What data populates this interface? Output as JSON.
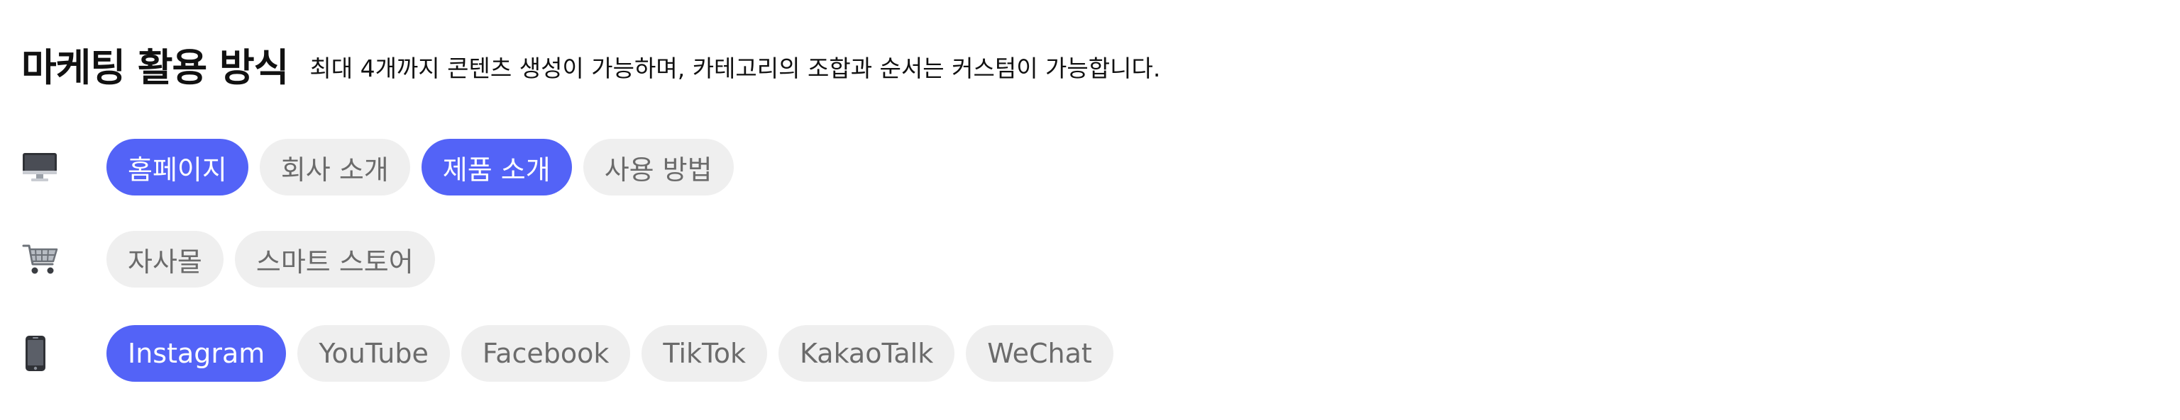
{
  "header": {
    "title": "마케팅 활용 방식",
    "subtitle": "최대 4개까지 콘텐츠 생성이 가능하며, 카테고리의 조합과 순서는 커스텀이 가능합니다."
  },
  "colors": {
    "selected_bg": "#5363f7",
    "selected_text": "#ffffff",
    "unselected_bg": "#efefef",
    "unselected_text": "#6b6b6b"
  },
  "rows": [
    {
      "icon": "desktop-computer-icon",
      "chips": [
        {
          "label": "홈페이지",
          "selected": true
        },
        {
          "label": "회사 소개",
          "selected": false
        },
        {
          "label": "제품 소개",
          "selected": true
        },
        {
          "label": "사용 방법",
          "selected": false
        }
      ]
    },
    {
      "icon": "shopping-cart-icon",
      "chips": [
        {
          "label": "자사몰",
          "selected": false
        },
        {
          "label": "스마트 스토어",
          "selected": false
        }
      ]
    },
    {
      "icon": "mobile-phone-icon",
      "chips": [
        {
          "label": "Instagram",
          "selected": true
        },
        {
          "label": "YouTube",
          "selected": false
        },
        {
          "label": "Facebook",
          "selected": false
        },
        {
          "label": "TikTok",
          "selected": false
        },
        {
          "label": "KakaoTalk",
          "selected": false
        },
        {
          "label": "WeChat",
          "selected": false
        }
      ]
    }
  ]
}
